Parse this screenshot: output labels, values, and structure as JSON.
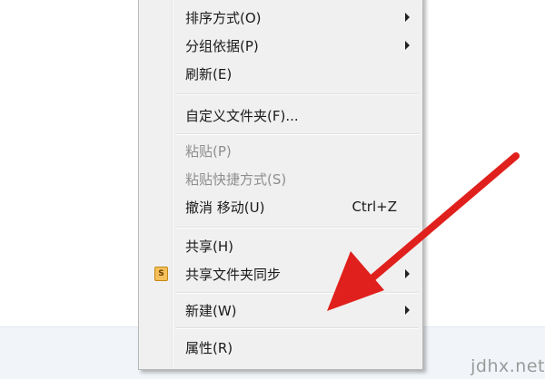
{
  "context_menu": {
    "items": [
      {
        "label": "排序方式(O)",
        "shortcut": "",
        "submenu": true,
        "disabled": false
      },
      {
        "label": "分组依据(P)",
        "shortcut": "",
        "submenu": true,
        "disabled": false
      },
      {
        "label": "刷新(E)",
        "shortcut": "",
        "submenu": false,
        "disabled": false
      },
      {
        "label": "自定义文件夹(F)...",
        "shortcut": "",
        "submenu": false,
        "disabled": false
      },
      {
        "label": "粘贴(P)",
        "shortcut": "",
        "submenu": false,
        "disabled": true
      },
      {
        "label": "粘贴快捷方式(S)",
        "shortcut": "",
        "submenu": false,
        "disabled": true
      },
      {
        "label": "撤消 移动(U)",
        "shortcut": "Ctrl+Z",
        "submenu": false,
        "disabled": false
      },
      {
        "label": "共享(H)",
        "shortcut": "",
        "submenu": false,
        "disabled": false
      },
      {
        "label": "共享文件夹同步",
        "shortcut": "",
        "submenu": true,
        "disabled": false,
        "icon": "sync-share-icon",
        "icon_letter": "S"
      },
      {
        "label": "新建(W)",
        "shortcut": "",
        "submenu": true,
        "disabled": false
      },
      {
        "label": "属性(R)",
        "shortcut": "",
        "submenu": false,
        "disabled": false
      }
    ]
  },
  "annotation": {
    "arrow_color": "#e0201c",
    "icon": "red-arrow-icon"
  },
  "watermark": {
    "text": "jdhx.net"
  }
}
